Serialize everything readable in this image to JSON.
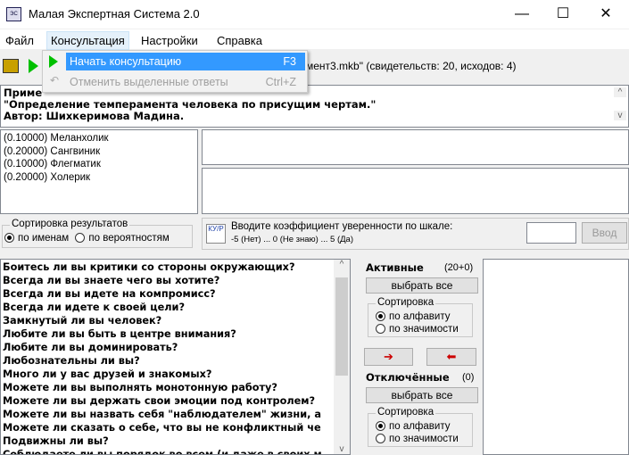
{
  "window": {
    "title": "Малая Экспертная Система 2.0",
    "icon_text": "ЭС",
    "min": "—",
    "max": "☐",
    "close": "✕"
  },
  "menu": [
    "Файл",
    "Консультация",
    "Настройки",
    "Справка"
  ],
  "dropdown": [
    {
      "label": "Начать консультацию",
      "shortcut": "F3",
      "enabled": true
    },
    {
      "label": "Отменить выделенные ответы",
      "shortcut": "Ctrl+Z",
      "enabled": false
    }
  ],
  "toolbar": {
    "status": "мент3.mkb\" (свидетельств: 20, исходов: 4)"
  },
  "info": [
    "Приме",
    "\"Определение темперамента человека по присущим чертам.\"",
    "Автор: Шихкеримова Мадина."
  ],
  "results": [
    "(0.10000)  Меланхолик",
    "(0.20000)  Сангвиник",
    "(0.10000)  Флегматик",
    "(0.20000)  Холерик"
  ],
  "sort_results": {
    "legend": "Сортировка результатов",
    "by_name": "по именам",
    "by_prob": "по вероятностям"
  },
  "input": {
    "icon_text": "КУ/Р",
    "prompt": "Вводите коэффициент уверенности по шкале:",
    "scale": "-5 (Нет) ... 0 (Не знаю) ... 5 (Да)",
    "value": "",
    "button": "Ввод"
  },
  "questions": [
    "Боитесь ли вы критики со стороны окружающих?",
    "Всегда ли вы знаете чего вы хотите?",
    "Всегда ли вы идете на компромисс?",
    "Всегда ли идете к своей цели?",
    "Замкнутый ли вы человек?",
    "Любите ли вы быть в центре внимания?",
    "Любите ли вы доминировать?",
    "Любознательны ли вы?",
    "Много ли у вас друзей и знакомых?",
    "Можете ли вы выполнять монотонную работу?",
    "Можете ли вы держать свои эмоции под контролем?",
    "Можете ли вы назвать себя \"наблюдателем\" жизни, а",
    "Можете ли сказать о себе, что вы не конфликтный че",
    "Подвижны ли вы?",
    "Соблюдаете ли вы порядок во всем (и даже в своих м"
  ],
  "active": {
    "label": "Активные",
    "count": "(20+0)",
    "select_all": "выбрать все",
    "sort_legend": "Сортировка",
    "alpha": "по алфавиту",
    "weight": "по значимости"
  },
  "disabled": {
    "label": "Отключённые",
    "count": "(0)",
    "select_all": "выбрать все",
    "sort_legend": "Сортировка",
    "alpha": "по алфавиту",
    "weight": "по значимости"
  },
  "arrows": {
    "right": "➔",
    "left": "⬅"
  },
  "colors": {
    "arrow": "#cc0000",
    "play": "#00c000",
    "highlight": "#3399ff"
  }
}
